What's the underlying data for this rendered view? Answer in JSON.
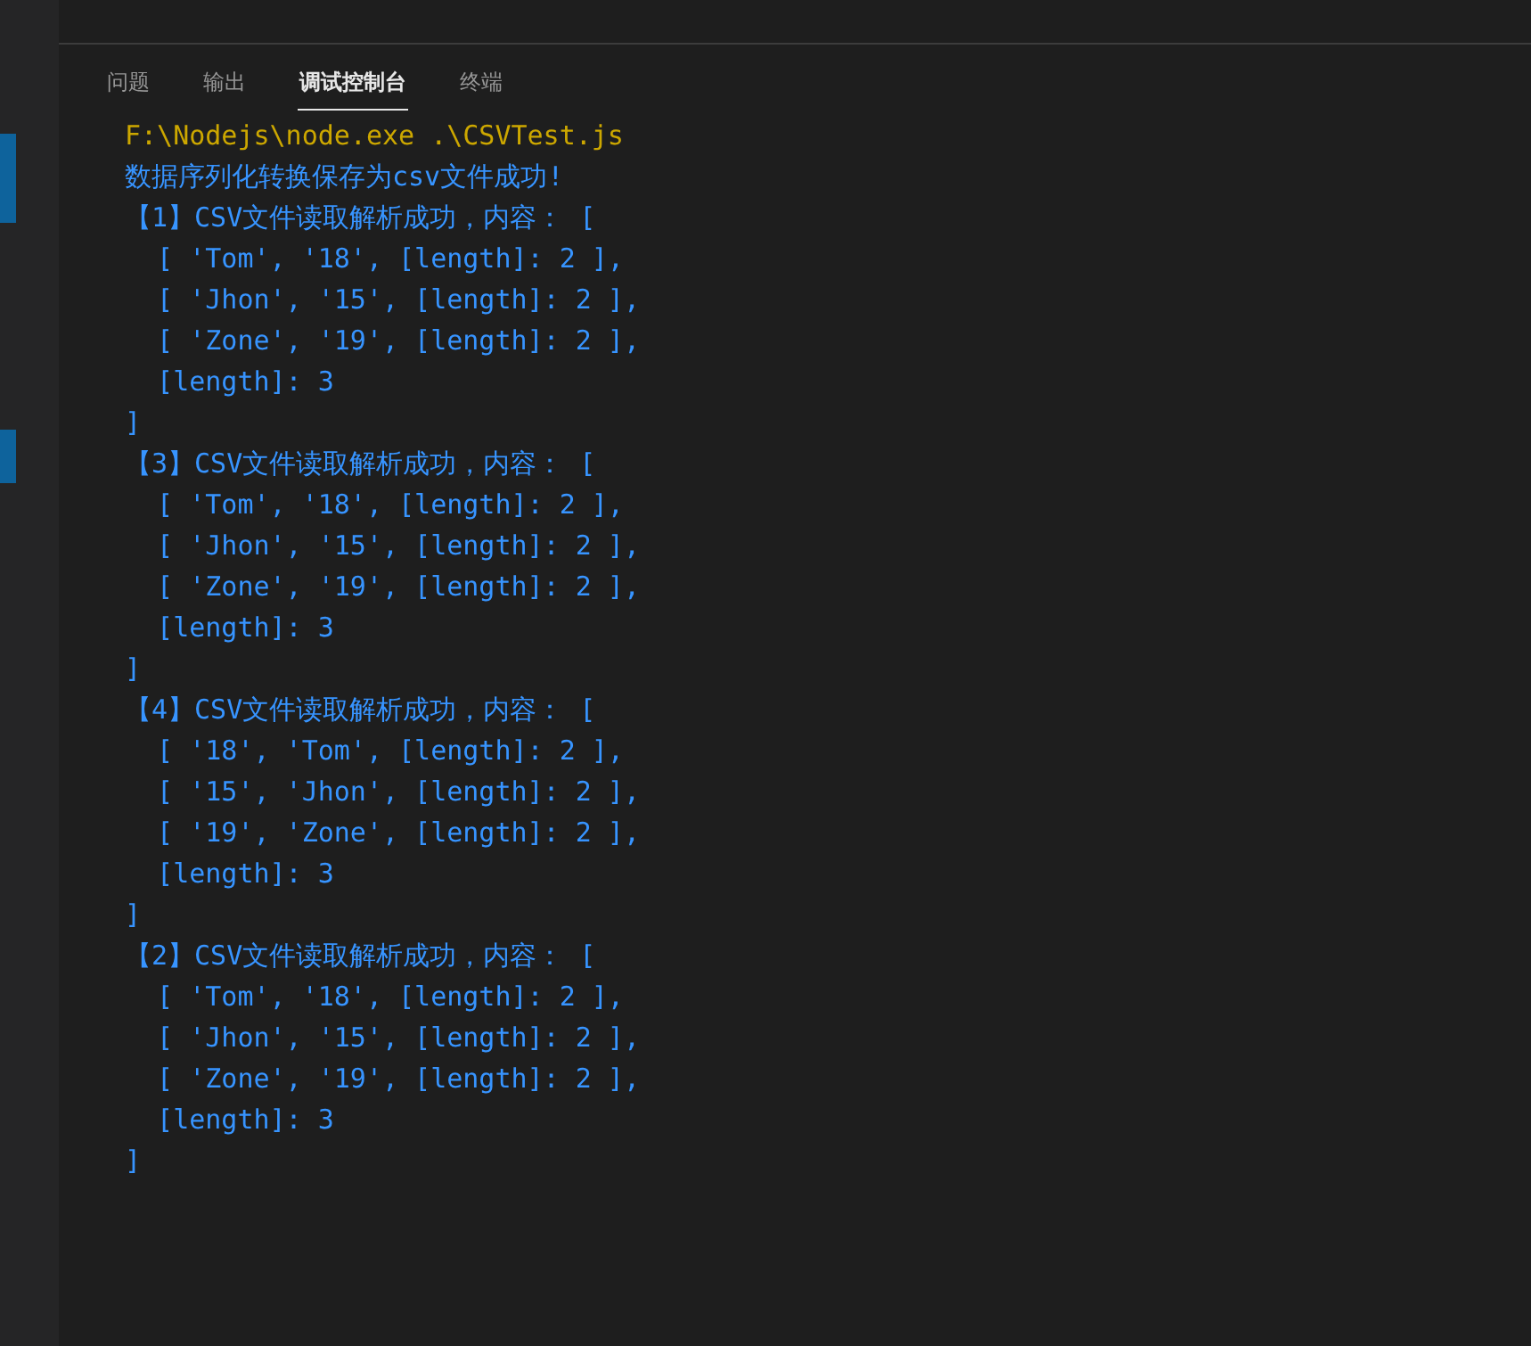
{
  "sidebar": {
    "markers": [
      {
        "selected": true
      },
      {
        "selected": true
      }
    ]
  },
  "panel": {
    "tabs": [
      {
        "label": "问题",
        "selected": false
      },
      {
        "label": "输出",
        "selected": false
      },
      {
        "label": "调试控制台",
        "selected": true
      },
      {
        "label": "终端",
        "selected": false
      }
    ]
  },
  "console": {
    "lines": [
      {
        "kind": "command",
        "text": "F:\\Nodejs\\node.exe .\\CSVTest.js"
      },
      {
        "kind": "output",
        "text": "数据序列化转换保存为csv文件成功!"
      },
      {
        "kind": "output",
        "text": "【1】CSV文件读取解析成功，内容： ["
      },
      {
        "kind": "output",
        "text": "  [ 'Tom', '18', [length]: 2 ],"
      },
      {
        "kind": "output",
        "text": "  [ 'Jhon', '15', [length]: 2 ],"
      },
      {
        "kind": "output",
        "text": "  [ 'Zone', '19', [length]: 2 ],"
      },
      {
        "kind": "output",
        "text": "  [length]: 3"
      },
      {
        "kind": "output",
        "text": "]"
      },
      {
        "kind": "output",
        "text": "【3】CSV文件读取解析成功，内容： ["
      },
      {
        "kind": "output",
        "text": "  [ 'Tom', '18', [length]: 2 ],"
      },
      {
        "kind": "output",
        "text": "  [ 'Jhon', '15', [length]: 2 ],"
      },
      {
        "kind": "output",
        "text": "  [ 'Zone', '19', [length]: 2 ],"
      },
      {
        "kind": "output",
        "text": "  [length]: 3"
      },
      {
        "kind": "output",
        "text": "]"
      },
      {
        "kind": "output",
        "text": "【4】CSV文件读取解析成功，内容： ["
      },
      {
        "kind": "output",
        "text": "  [ '18', 'Tom', [length]: 2 ],"
      },
      {
        "kind": "output",
        "text": "  [ '15', 'Jhon', [length]: 2 ],"
      },
      {
        "kind": "output",
        "text": "  [ '19', 'Zone', [length]: 2 ],"
      },
      {
        "kind": "output",
        "text": "  [length]: 3"
      },
      {
        "kind": "output",
        "text": "]"
      },
      {
        "kind": "output",
        "text": "【2】CSV文件读取解析成功，内容： ["
      },
      {
        "kind": "output",
        "text": "  [ 'Tom', '18', [length]: 2 ],"
      },
      {
        "kind": "output",
        "text": "  [ 'Jhon', '15', [length]: 2 ],"
      },
      {
        "kind": "output",
        "text": "  [ 'Zone', '19', [length]: 2 ],"
      },
      {
        "kind": "output",
        "text": "  [length]: 3"
      },
      {
        "kind": "output",
        "text": "]"
      }
    ]
  }
}
